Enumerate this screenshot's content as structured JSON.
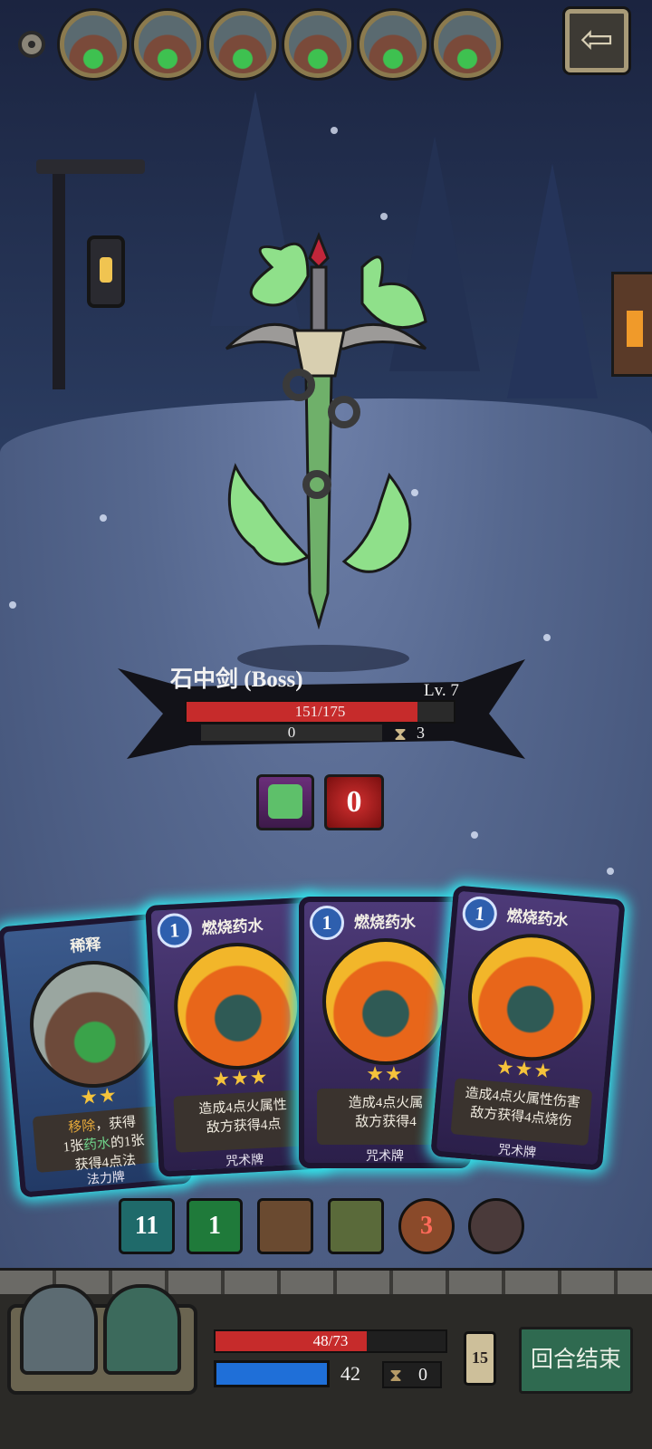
{
  "top_bar": {
    "settings_icon": "gear-icon",
    "party_count": 6,
    "back_icon": "arrow-left-icon"
  },
  "boss": {
    "name": "石中剑 (Boss)",
    "level": "Lv. 7",
    "hp_text": "151/175",
    "hp_fraction": 0.863,
    "shield": "0",
    "turn_counter": "3",
    "buffs": [
      {
        "icon": "sword-in-goo-icon"
      },
      {
        "icon": "burn-counter-icon",
        "value": "0"
      }
    ]
  },
  "hand": {
    "cards": [
      {
        "title": "稀释",
        "cost": "",
        "stars": "★★",
        "desc_parts": [
          {
            "t": "移除",
            "c": "hi2"
          },
          {
            "t": "，获得"
          },
          {
            "t": "1张"
          },
          {
            "t": "药水",
            "c": "hi3"
          },
          {
            "t": "的1张"
          }
        ],
        "desc_line2": "获得4点法",
        "type": "法力牌",
        "art": "water"
      },
      {
        "title": "燃烧药水",
        "cost": "1",
        "stars": "★★★",
        "desc_line1": "造成4点火属性",
        "desc_line2": "敌方获得4点",
        "type": "咒术牌",
        "art": "fire"
      },
      {
        "title": "燃烧药水",
        "cost": "1",
        "stars": "★★",
        "desc_line1": "造成4点火属",
        "desc_line2": "敌方获得4",
        "type": "咒术牌",
        "art": "fire"
      },
      {
        "title": "燃烧药水",
        "cost": "1",
        "stars": "★★★",
        "desc_line1": "造成4点火属性伤害",
        "desc_line2": "敌方获得4点烧伤",
        "type": "咒术牌",
        "art": "fire"
      }
    ]
  },
  "status_icons": [
    {
      "name": "deck-icon",
      "value": "11"
    },
    {
      "name": "green-spark-icon",
      "value": "1"
    },
    {
      "name": "barrel-icon",
      "value": ""
    },
    {
      "name": "snake-icon",
      "value": ""
    },
    {
      "name": "potion-ring-icon",
      "value": "3"
    },
    {
      "name": "cauldron-icon",
      "value": ""
    }
  ],
  "player": {
    "hp_text": "48/73",
    "hp_fraction": 0.658,
    "mana": "42",
    "turns": "0",
    "deck_count": "15",
    "end_turn_label": "回合结束"
  }
}
